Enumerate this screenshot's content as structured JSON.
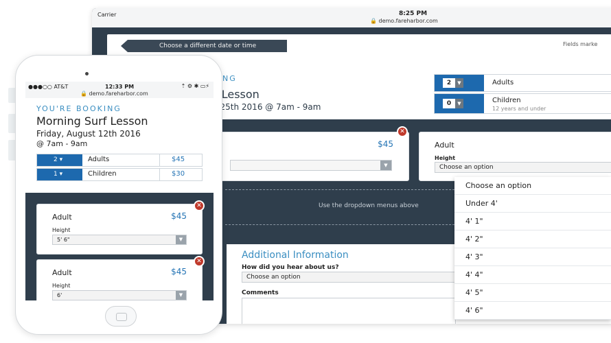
{
  "tablet": {
    "status": {
      "carrier": "Carrier",
      "time": "8:25 PM",
      "url": "demo.fareharbor.com"
    },
    "back_button": "Choose a different date or time",
    "fields_note": "Fields marke",
    "booking": {
      "youre_booking": "NG",
      "title": "f Lesson",
      "date": "t 25th 2016 @ 7am - 9am"
    },
    "quantities": [
      {
        "count": "2",
        "label": "Adults",
        "sublabel": ""
      },
      {
        "count": "0",
        "label": "Children",
        "sublabel": "12 years and under"
      }
    ],
    "card1": {
      "price": "$45"
    },
    "card2": {
      "title": "Adult",
      "height_label": "Height",
      "select_value": "Choose an option"
    },
    "dropdown_hint": "Use the dropdown menus above",
    "additional": {
      "title": "Additional Information",
      "question": "How did you hear about us?",
      "question_value": "Choose an option",
      "comments_label": "Comments"
    },
    "height_options": [
      "Choose an option",
      "Under 4'",
      "4' 1\"",
      "4' 2\"",
      "4' 3\"",
      "4' 4\"",
      "4' 5\"",
      "4' 6\""
    ]
  },
  "phone": {
    "status": {
      "carrier": "●●●○○ AT&T",
      "time": "12:33 PM",
      "battery": "⚡",
      "url": "demo.fareharbor.com"
    },
    "booking": {
      "youre_booking": "YOU'RE BOOKING",
      "title": "Morning Surf Lesson",
      "date_line1": "Friday, August 12th 2016",
      "date_line2": "@ 7am - 9am"
    },
    "quantities": [
      {
        "count": "2 ▾",
        "label": "Adults",
        "price": "$45"
      },
      {
        "count": "1 ▾",
        "label": "Children",
        "price": "$30"
      }
    ],
    "cards": [
      {
        "title": "Adult",
        "price": "$45",
        "height_label": "Height",
        "height_value": "5' 6\""
      },
      {
        "title": "Adult",
        "price": "$45",
        "height_label": "Height",
        "height_value": "6'"
      }
    ]
  },
  "colors": {
    "accent": "#1d69ae",
    "link": "#3a8ec1",
    "remove": "#c0392b",
    "dark": "#2f3e4c"
  }
}
